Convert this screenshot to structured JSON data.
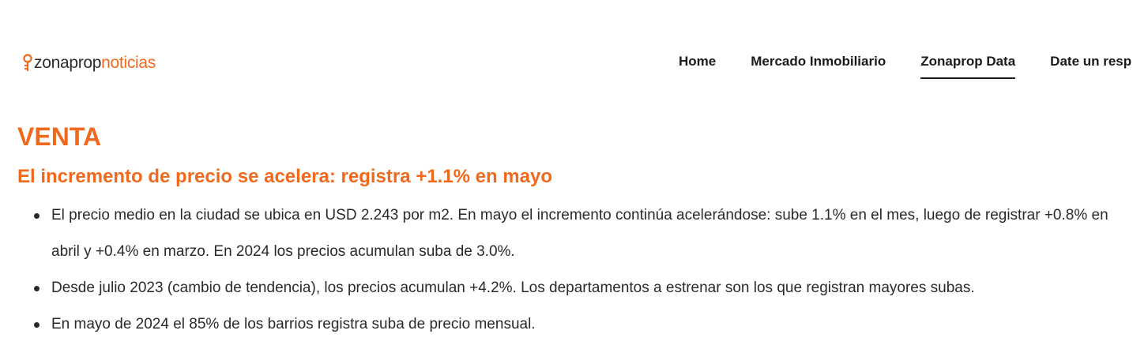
{
  "header": {
    "logo": {
      "part_a": "zonaprop",
      "part_b": "noticias",
      "icon": "key-icon",
      "accent_color": "#f06a1e"
    },
    "nav": [
      {
        "label": "Home",
        "active": false
      },
      {
        "label": "Mercado Inmobiliario",
        "active": false
      },
      {
        "label": "Zonaprop Data",
        "active": true
      },
      {
        "label": "Date un resp",
        "active": false
      }
    ]
  },
  "main": {
    "section_title": "VENTA",
    "subtitle": "El incremento de precio se acelera: registra +1.1% en mayo",
    "bullets": [
      {
        "text": "El precio medio en la ciudad se ubica en USD 2.243 por m2. En mayo el incremento continúa acelerándose: sube 1.1% en el mes, luego de registrar +0.8% en abril y +0.4% en marzo. En 2024 los precios acumulan suba de 3.0%."
      },
      {
        "text": "Desde julio 2023 (cambio de tendencia), los precios acumulan +4.2%. Los departamentos a estrenar son los que registran mayores subas."
      },
      {
        "text": "En mayo de 2024 el 85% de los barrios registra suba de precio mensual."
      }
    ]
  }
}
